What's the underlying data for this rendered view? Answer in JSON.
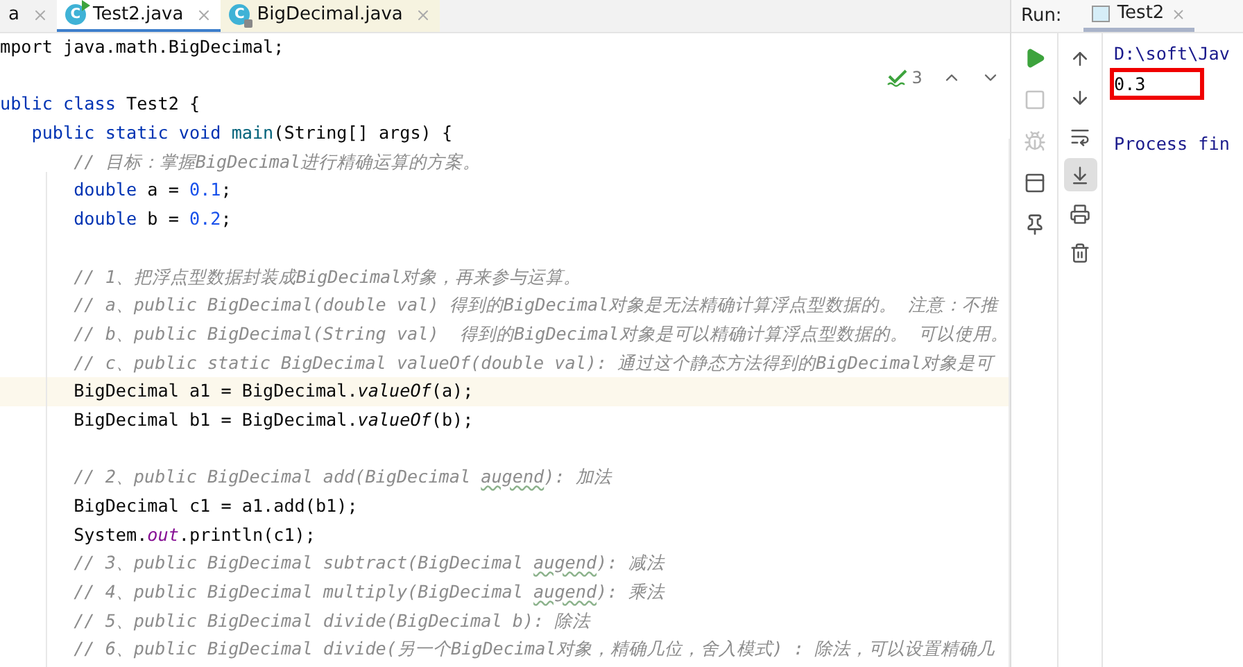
{
  "editor_tabs": [
    {
      "label": "a",
      "selected": false,
      "kind": "plain"
    },
    {
      "label": "Test2.java",
      "selected": true,
      "kind": "runnable_class",
      "icon_text": "C"
    },
    {
      "label": "BigDecimal.java",
      "selected": false,
      "kind": "library_class",
      "icon_text": "C"
    }
  ],
  "inspection": {
    "count": "3"
  },
  "code_lines": [
    {
      "kind": "code",
      "current": false,
      "segments": [
        {
          "text": "mport java.math.BigDecimal;",
          "kind": "plain"
        }
      ]
    },
    {
      "kind": "blank",
      "current": false
    },
    {
      "kind": "code",
      "current": false,
      "segments": [
        {
          "text": "ublic class",
          "kind": "keyword"
        },
        {
          "text": " Test2 {",
          "kind": "plain"
        }
      ]
    },
    {
      "kind": "code",
      "current": false,
      "segments": [
        {
          "text": "   public static void ",
          "kind": "keyword"
        },
        {
          "text": "main",
          "kind": "declaration"
        },
        {
          "text": "(String[] args) {",
          "kind": "plain"
        }
      ]
    },
    {
      "kind": "code",
      "current": false,
      "segments": [
        {
          "text": "       // 目标：掌握BigDecimal进行精确运算的方案。",
          "kind": "comment"
        }
      ]
    },
    {
      "kind": "code",
      "current": false,
      "segments": [
        {
          "text": "       double",
          "kind": "keyword"
        },
        {
          "text": " a = ",
          "kind": "plain"
        },
        {
          "text": "0.1",
          "kind": "number"
        },
        {
          "text": ";",
          "kind": "plain"
        }
      ]
    },
    {
      "kind": "code",
      "current": false,
      "segments": [
        {
          "text": "       double",
          "kind": "keyword"
        },
        {
          "text": " b = ",
          "kind": "plain"
        },
        {
          "text": "0.2",
          "kind": "number"
        },
        {
          "text": ";",
          "kind": "plain"
        }
      ]
    },
    {
      "kind": "blank",
      "current": false
    },
    {
      "kind": "code",
      "current": false,
      "segments": [
        {
          "text": "       // 1、把浮点型数据封装成BigDecimal对象，再来参与运算。",
          "kind": "comment"
        }
      ]
    },
    {
      "kind": "code",
      "current": false,
      "segments": [
        {
          "text": "       // a、public BigDecimal(double val) 得到的BigDecimal对象是无法精确计算浮点型数据的。 注意：不推",
          "kind": "comment"
        }
      ]
    },
    {
      "kind": "code",
      "current": false,
      "segments": [
        {
          "text": "       // b、public BigDecimal(String val)  得到的BigDecimal对象是可以精确计算浮点型数据的。 可以使用。",
          "kind": "comment"
        }
      ]
    },
    {
      "kind": "code",
      "current": false,
      "segments": [
        {
          "text": "       // c、public static BigDecimal valueOf(double val): 通过这个静态方法得到的BigDecimal对象是可",
          "kind": "comment"
        }
      ]
    },
    {
      "kind": "code",
      "current": true,
      "segments": [
        {
          "text": "       BigDecimal a1 = BigDecimal.",
          "kind": "plain"
        },
        {
          "text": "valueOf",
          "kind": "static_call"
        },
        {
          "text": "(a);",
          "kind": "plain"
        }
      ]
    },
    {
      "kind": "code",
      "current": false,
      "segments": [
        {
          "text": "       BigDecimal b1 = BigDecimal.",
          "kind": "plain"
        },
        {
          "text": "valueOf",
          "kind": "static_call"
        },
        {
          "text": "(b);",
          "kind": "plain"
        }
      ]
    },
    {
      "kind": "blank",
      "current": false
    },
    {
      "kind": "code",
      "current": false,
      "segments": [
        {
          "text": "       // 2、public BigDecimal add(BigDecimal ",
          "kind": "comment"
        },
        {
          "text": "augend",
          "kind": "comment_typo"
        },
        {
          "text": "): 加法",
          "kind": "comment"
        }
      ]
    },
    {
      "kind": "code",
      "current": false,
      "segments": [
        {
          "text": "       BigDecimal c1 = a1.add(b1);",
          "kind": "plain"
        }
      ]
    },
    {
      "kind": "code",
      "current": false,
      "segments": [
        {
          "text": "       System.",
          "kind": "plain"
        },
        {
          "text": "out",
          "kind": "static_field"
        },
        {
          "text": ".println(c1);",
          "kind": "plain"
        }
      ]
    },
    {
      "kind": "code",
      "current": false,
      "segments": [
        {
          "text": "       // 3、public BigDecimal subtract(BigDecimal ",
          "kind": "comment"
        },
        {
          "text": "augend",
          "kind": "comment_typo"
        },
        {
          "text": "): 减法",
          "kind": "comment"
        }
      ]
    },
    {
      "kind": "code",
      "current": false,
      "segments": [
        {
          "text": "       // 4、public BigDecimal multiply(BigDecimal ",
          "kind": "comment"
        },
        {
          "text": "augend",
          "kind": "comment_typo"
        },
        {
          "text": "): 乘法",
          "kind": "comment"
        }
      ]
    },
    {
      "kind": "code",
      "current": false,
      "segments": [
        {
          "text": "       // 5、public BigDecimal divide(BigDecimal b): 除法",
          "kind": "comment"
        }
      ]
    },
    {
      "kind": "code",
      "current": false,
      "segments": [
        {
          "text": "       // 6、public BigDecimal divide(另一个BigDecimal对象，精确几位，舍入模式) : 除法，可以设置精确几",
          "kind": "comment"
        }
      ]
    }
  ],
  "run_panel": {
    "label": "Run:",
    "tab": {
      "label": "Test2",
      "selected": true
    },
    "left_tools": [
      {
        "kind": "rerun",
        "disabled": false
      },
      {
        "kind": "stop",
        "disabled": true
      },
      {
        "kind": "debug",
        "disabled": true
      },
      {
        "kind": "layout",
        "disabled": false
      },
      {
        "kind": "pin",
        "disabled": false
      }
    ],
    "right_tools": [
      {
        "kind": "up",
        "on": false
      },
      {
        "kind": "down",
        "on": false
      },
      {
        "kind": "wrap",
        "on": false
      },
      {
        "kind": "scroll_end",
        "on": true
      },
      {
        "kind": "print",
        "on": false
      },
      {
        "kind": "trash",
        "on": false
      }
    ],
    "console": [
      {
        "text": "D:\\soft\\Jav",
        "kind": "command",
        "highlighted": false
      },
      {
        "text": "0.3",
        "kind": "output",
        "highlighted": true
      },
      {
        "text": "Process fin",
        "kind": "status",
        "highlighted": false
      }
    ]
  }
}
